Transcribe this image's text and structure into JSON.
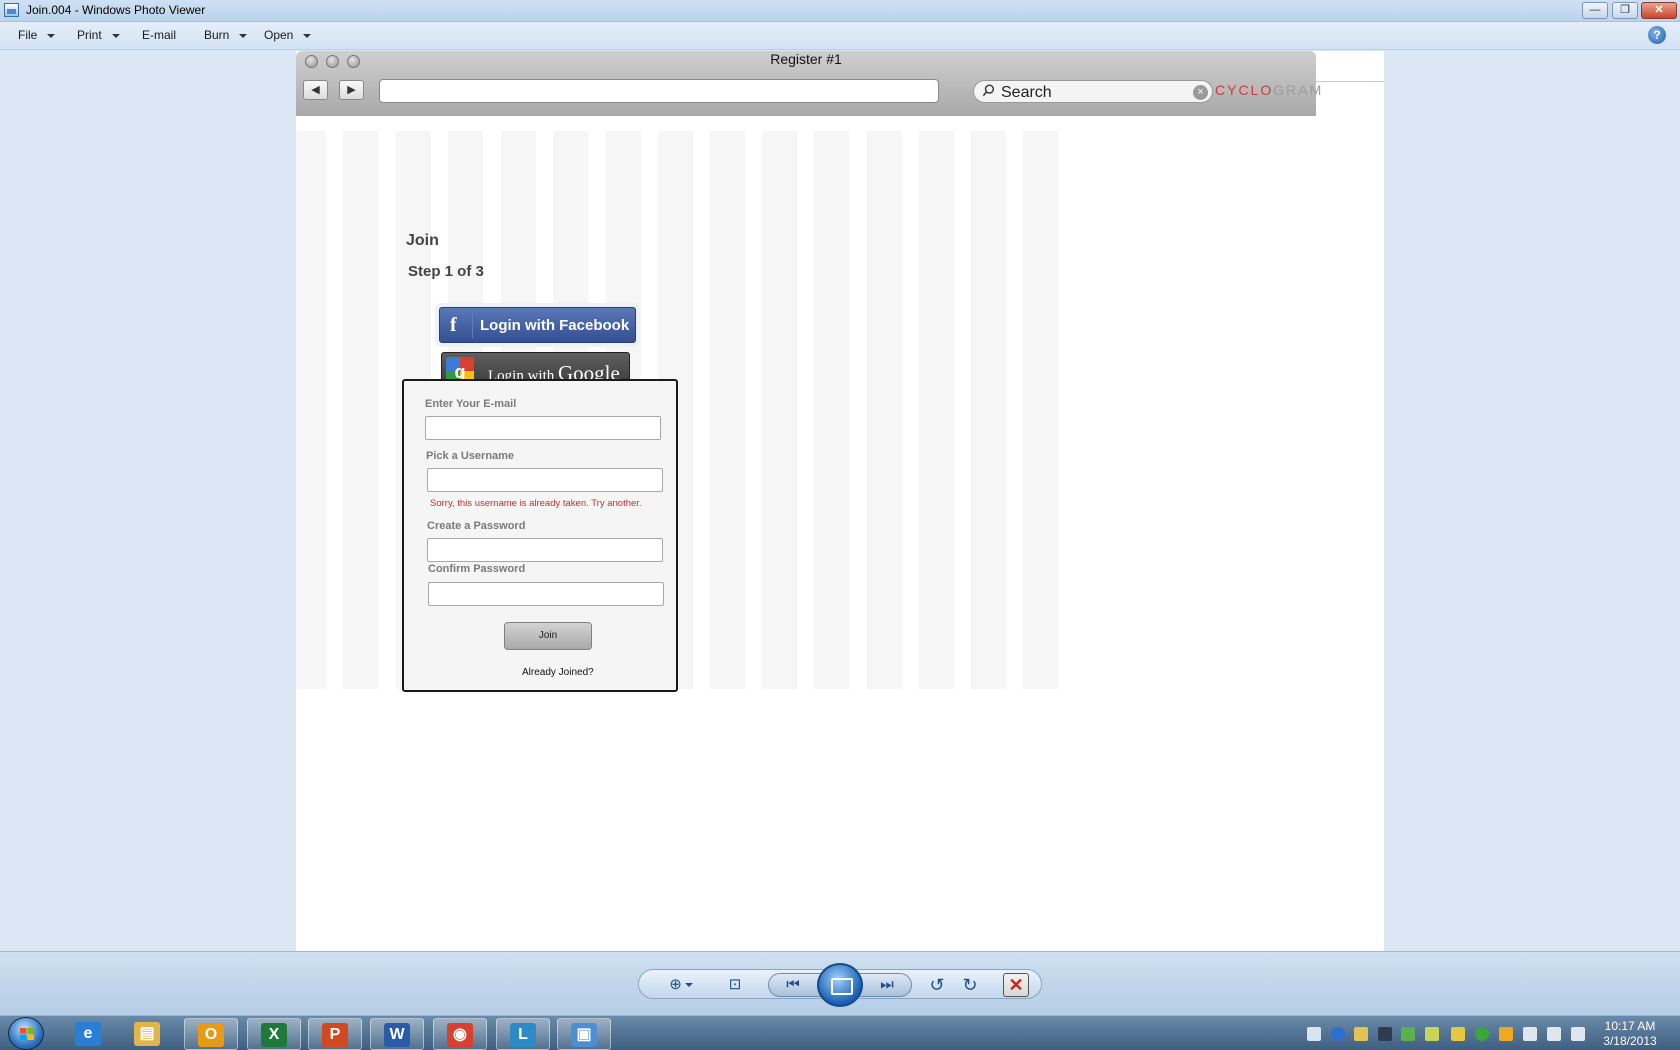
{
  "window": {
    "title": "Join.004 - Windows Photo Viewer",
    "minimize_glyph": "—",
    "restore_glyph": "❐",
    "close_glyph": "✕"
  },
  "menu": {
    "items": [
      {
        "label": "File",
        "has_dropdown": true
      },
      {
        "label": "Print",
        "has_dropdown": true
      },
      {
        "label": "E-mail",
        "has_dropdown": false
      },
      {
        "label": "Burn",
        "has_dropdown": true
      },
      {
        "label": "Open",
        "has_dropdown": true
      }
    ],
    "help_glyph": "?"
  },
  "mockup": {
    "window_title": "Register #1",
    "back_glyph": "◀",
    "forward_glyph": "▶",
    "search_placeholder": "Search",
    "clear_glyph": "×",
    "brand_name": {
      "prefix": "CYCL",
      "accent": "O",
      "suffix": "GRAM"
    },
    "page": {
      "title": "Join",
      "step": "Step 1 of 3",
      "facebook_button": "Login with Facebook",
      "google_button": {
        "small": "Login with",
        "big": "Google"
      },
      "form": {
        "email_label": "Enter Your E-mail",
        "username_label": "Pick a Username",
        "username_error": "Sorry, this username is already taken. Try another.",
        "password_label": "Create a Password",
        "confirm_label": "Confirm Password",
        "join_button": "Join",
        "already_joined_link": "Already Joined?"
      }
    }
  },
  "viewer_controls": {
    "zoom_glyph": "⊕",
    "fit_glyph": "⊡",
    "prev_glyph": "⏮",
    "next_glyph": "⏭",
    "rotate_ccw_glyph": "↺",
    "rotate_cw_glyph": "↻",
    "delete_glyph": "✕"
  },
  "taskbar": {
    "apps": [
      {
        "name": "internet-explorer",
        "glyph": "e",
        "color": "#2a7fd4"
      },
      {
        "name": "windows-explorer",
        "glyph": "▤",
        "color": "#e2b54a"
      },
      {
        "name": "outlook",
        "glyph": "O",
        "color": "#e69a1a"
      },
      {
        "name": "excel",
        "glyph": "X",
        "color": "#1f7a3a"
      },
      {
        "name": "powerpoint",
        "glyph": "P",
        "color": "#d04a21"
      },
      {
        "name": "word",
        "glyph": "W",
        "color": "#2a5aa8"
      },
      {
        "name": "chrome",
        "glyph": "◉",
        "color": "#d8412f"
      },
      {
        "name": "lync",
        "glyph": "L",
        "color": "#2d8ac7"
      },
      {
        "name": "photo-viewer",
        "glyph": "▣",
        "color": "#4f8ed3"
      }
    ],
    "clock": {
      "time": "10:17 AM",
      "date": "3/18/2013"
    }
  }
}
